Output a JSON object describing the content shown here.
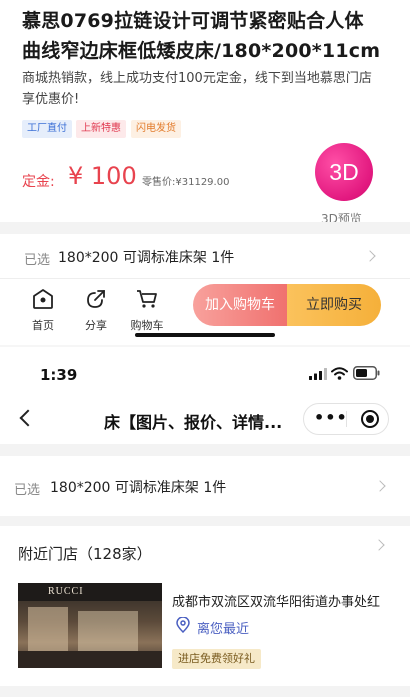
{
  "product": {
    "title": "慕思0769拉链设计可调节紧密贴合人体曲线窄边床框低矮皮床/180*200*11cm",
    "description": "商城热销款，线上成功支付100元定金，线下到当地慕思门店享优惠价!",
    "tags": [
      "工厂直付",
      "上新特惠",
      "闪电发货"
    ],
    "deposit_label": "定金:",
    "deposit_value": "¥ 100",
    "retail_label": "零售价:",
    "retail_value": "¥31129.00",
    "preview_badge": "3D",
    "preview_label": "3D预览"
  },
  "selection": {
    "label": "已选",
    "value": "180*200 可调标准床架 1件"
  },
  "action_bar": {
    "home_label": "首页",
    "share_label": "分享",
    "cart_label": "购物车",
    "add_to_cart_label": "加入购物车",
    "buy_now_label": "立即购买"
  },
  "status_bar": {
    "time": "1:39"
  },
  "nav_bar": {
    "title": "床【图片、报价、详情..."
  },
  "selection2": {
    "label": "已选",
    "value": "180*200 可调标准床架 1件"
  },
  "stores": {
    "title": "附近门店（128家）",
    "items": [
      {
        "photo_brand": "RUCCI",
        "address": "成都市双流区双流华阳街道办事处红",
        "distance": "离您最近",
        "badge": "进店免费领好礼"
      }
    ]
  },
  "colors": {
    "price": "#e8434e",
    "accent_3d": "#e2187f",
    "add_to_cart": "#f0716f",
    "buy_now": "#f5b03a",
    "location": "#4a5fc1"
  }
}
